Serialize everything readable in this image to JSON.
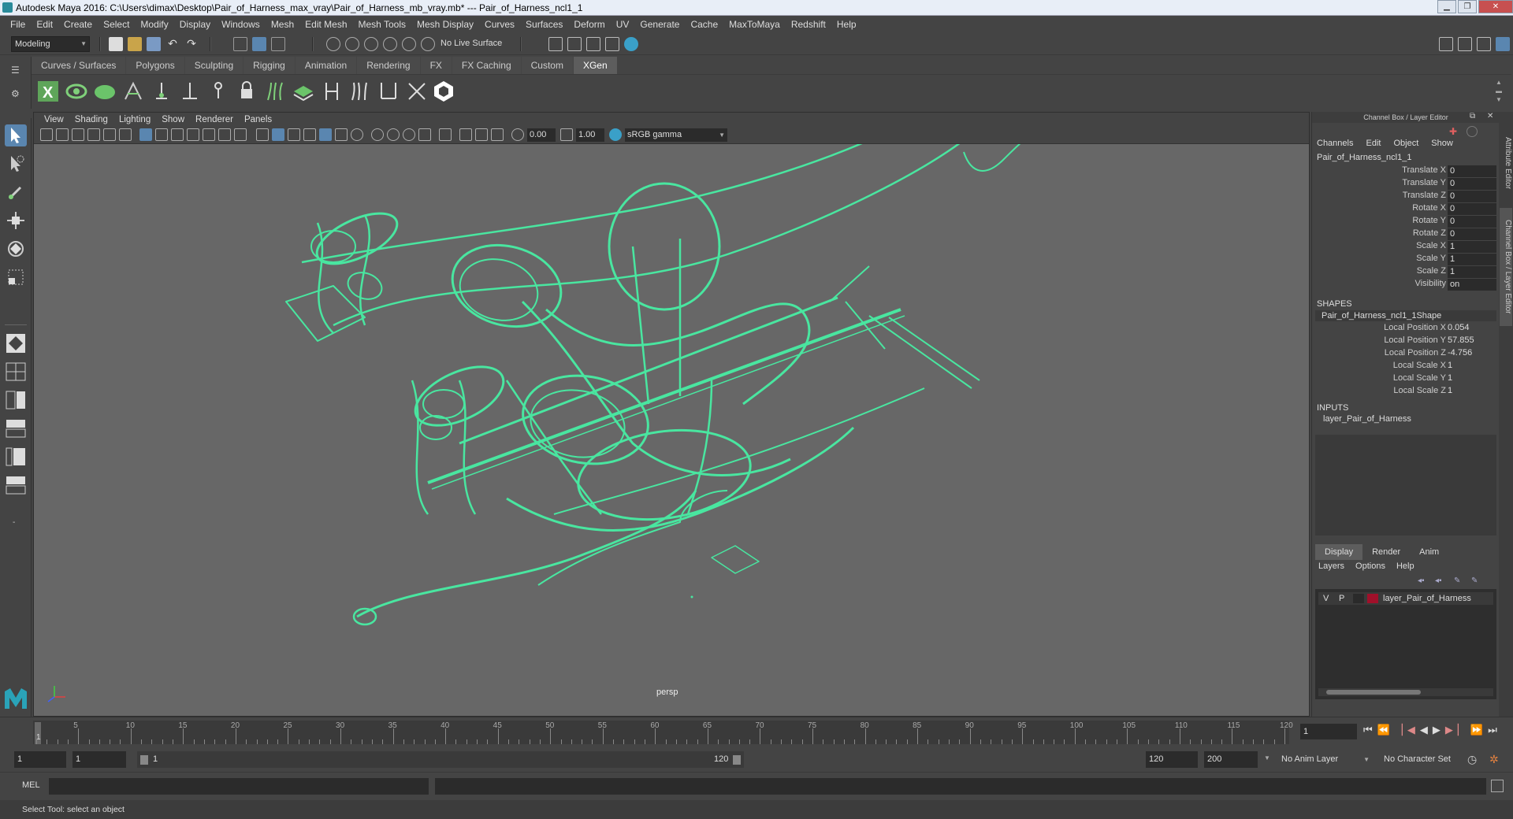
{
  "window": {
    "title": "Autodesk Maya 2016: C:\\Users\\dimax\\Desktop\\Pair_of_Harness_max_vray\\Pair_of_Harness_mb_vray.mb*   ---   Pair_of_Harness_ncl1_1"
  },
  "menubar": [
    "File",
    "Edit",
    "Create",
    "Select",
    "Modify",
    "Display",
    "Windows",
    "Mesh",
    "Edit Mesh",
    "Mesh Tools",
    "Mesh Display",
    "Curves",
    "Surfaces",
    "Deform",
    "UV",
    "Generate",
    "Cache",
    "MaxToMaya",
    "Redshift",
    "Help"
  ],
  "statusline": {
    "mode": "Modeling",
    "live_surface": "No Live Surface"
  },
  "shelf_tabs": [
    "Curves / Surfaces",
    "Polygons",
    "Sculpting",
    "Rigging",
    "Animation",
    "Rendering",
    "FX",
    "FX Caching",
    "Custom",
    "XGen"
  ],
  "shelf_active": "XGen",
  "viewport": {
    "menu": [
      "View",
      "Shading",
      "Lighting",
      "Show",
      "Renderer",
      "Panels"
    ],
    "exposure": "0.00",
    "gamma": "1.00",
    "colorspace": "sRGB gamma",
    "camera_label": "persp",
    "wire_color": "#49e6a0"
  },
  "channel_box": {
    "header": "Channel Box / Layer Editor",
    "menu": [
      "Channels",
      "Edit",
      "Object",
      "Show"
    ],
    "object_name": "Pair_of_Harness_ncl1_1",
    "attributes": [
      {
        "label": "Translate X",
        "value": "0"
      },
      {
        "label": "Translate Y",
        "value": "0"
      },
      {
        "label": "Translate Z",
        "value": "0"
      },
      {
        "label": "Rotate X",
        "value": "0"
      },
      {
        "label": "Rotate Y",
        "value": "0"
      },
      {
        "label": "Rotate Z",
        "value": "0"
      },
      {
        "label": "Scale X",
        "value": "1"
      },
      {
        "label": "Scale Y",
        "value": "1"
      },
      {
        "label": "Scale Z",
        "value": "1"
      },
      {
        "label": "Visibility",
        "value": "on"
      }
    ],
    "shapes_header": "SHAPES",
    "shape_name": "Pair_of_Harness_ncl1_1Shape",
    "shape_attributes": [
      {
        "label": "Local Position X",
        "value": "0.054"
      },
      {
        "label": "Local Position Y",
        "value": "57.855"
      },
      {
        "label": "Local Position Z",
        "value": "-4.756"
      },
      {
        "label": "Local Scale X",
        "value": "1"
      },
      {
        "label": "Local Scale Y",
        "value": "1"
      },
      {
        "label": "Local Scale Z",
        "value": "1"
      }
    ],
    "inputs_header": "INPUTS",
    "input_name": "layer_Pair_of_Harness"
  },
  "layer_editor": {
    "tabs": [
      "Display",
      "Render",
      "Anim"
    ],
    "active_tab": "Display",
    "menu": [
      "Layers",
      "Options",
      "Help"
    ],
    "layer": {
      "v": "V",
      "p": "P",
      "name": "layer_Pair_of_Harness",
      "color": "#a0102a"
    }
  },
  "side_tabs": [
    "Attribute Editor",
    "Channel Box / Layer Editor"
  ],
  "timeline": {
    "tick_labels": [
      "5",
      "10",
      "15",
      "20",
      "25",
      "30",
      "35",
      "40",
      "45",
      "50",
      "55",
      "60",
      "65",
      "70",
      "75",
      "80",
      "85",
      "90",
      "95",
      "100",
      "105",
      "110",
      "115",
      "120"
    ],
    "first_label": "1",
    "current_frame": "1"
  },
  "range": {
    "start": "1",
    "playback_start": "1",
    "slider_start": "1",
    "slider_end": "120",
    "playback_end": "120",
    "end": "200",
    "anim_layer": "No Anim Layer",
    "character_set": "No Character Set"
  },
  "command_line": {
    "label": "MEL"
  },
  "help_line": "Select Tool: select an object"
}
